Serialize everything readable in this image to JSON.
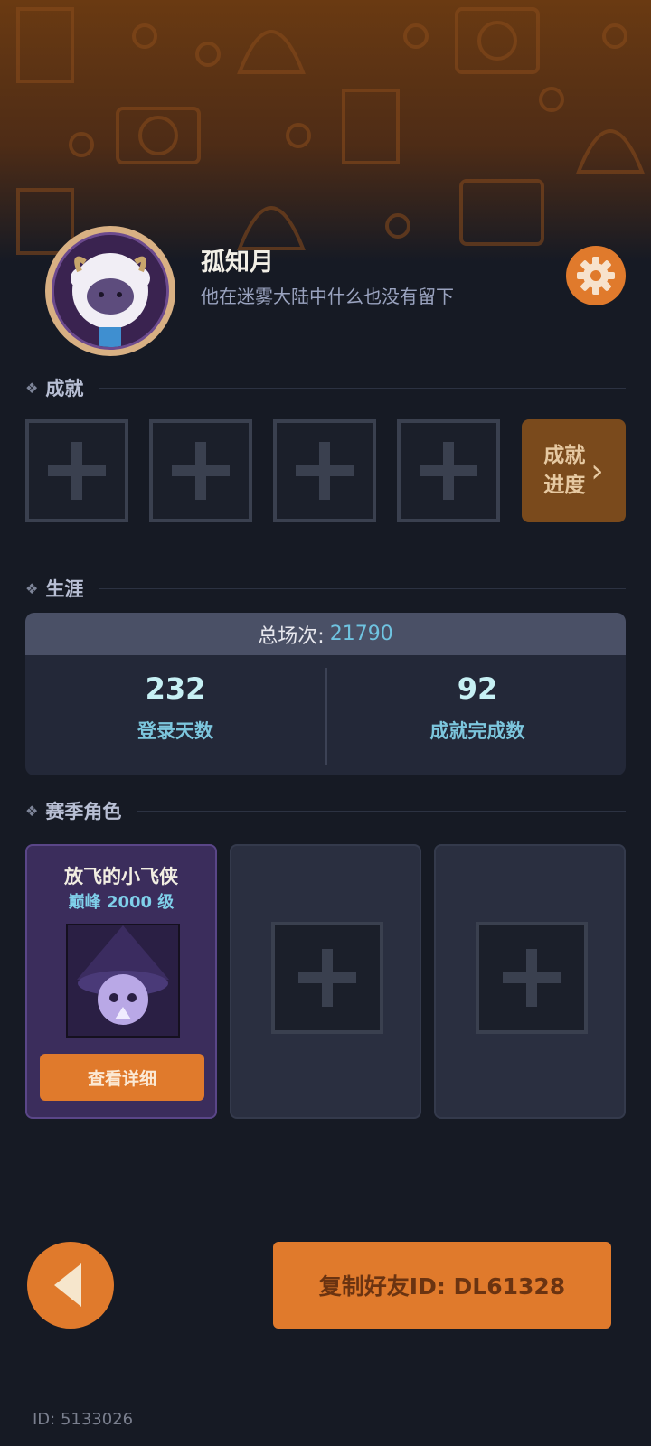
{
  "profile": {
    "name": "孤知月",
    "motto": "他在迷雾大陆中什么也没有留下",
    "settings_icon": "gear-icon"
  },
  "achievements": {
    "section_label": "成就",
    "slots": [
      "empty",
      "empty",
      "empty",
      "empty"
    ],
    "progress_label_line1": "成就",
    "progress_label_line2": "进度",
    "progress_icon": "chevron-right-icon"
  },
  "career": {
    "section_label": "生涯",
    "total_label": "总场次:",
    "total_value": "21790",
    "stats": [
      {
        "value": "232",
        "label": "登录天数"
      },
      {
        "value": "92",
        "label": "成就完成数"
      }
    ]
  },
  "season": {
    "section_label": "赛季角色",
    "heroes": [
      {
        "name": "放飞的小飞侠",
        "level": "巅峰 2000 级",
        "button": "查看详细"
      }
    ],
    "empty_slots": 2
  },
  "footer": {
    "back_icon": "back-arrow-icon",
    "copy_button": "复制好友ID: DL61328",
    "user_id": "ID: 5133026"
  },
  "colors": {
    "accent": "#e07a2c",
    "background": "#161a24",
    "stat_value": "#c6f0f4",
    "stat_label": "#7cc6dd"
  }
}
